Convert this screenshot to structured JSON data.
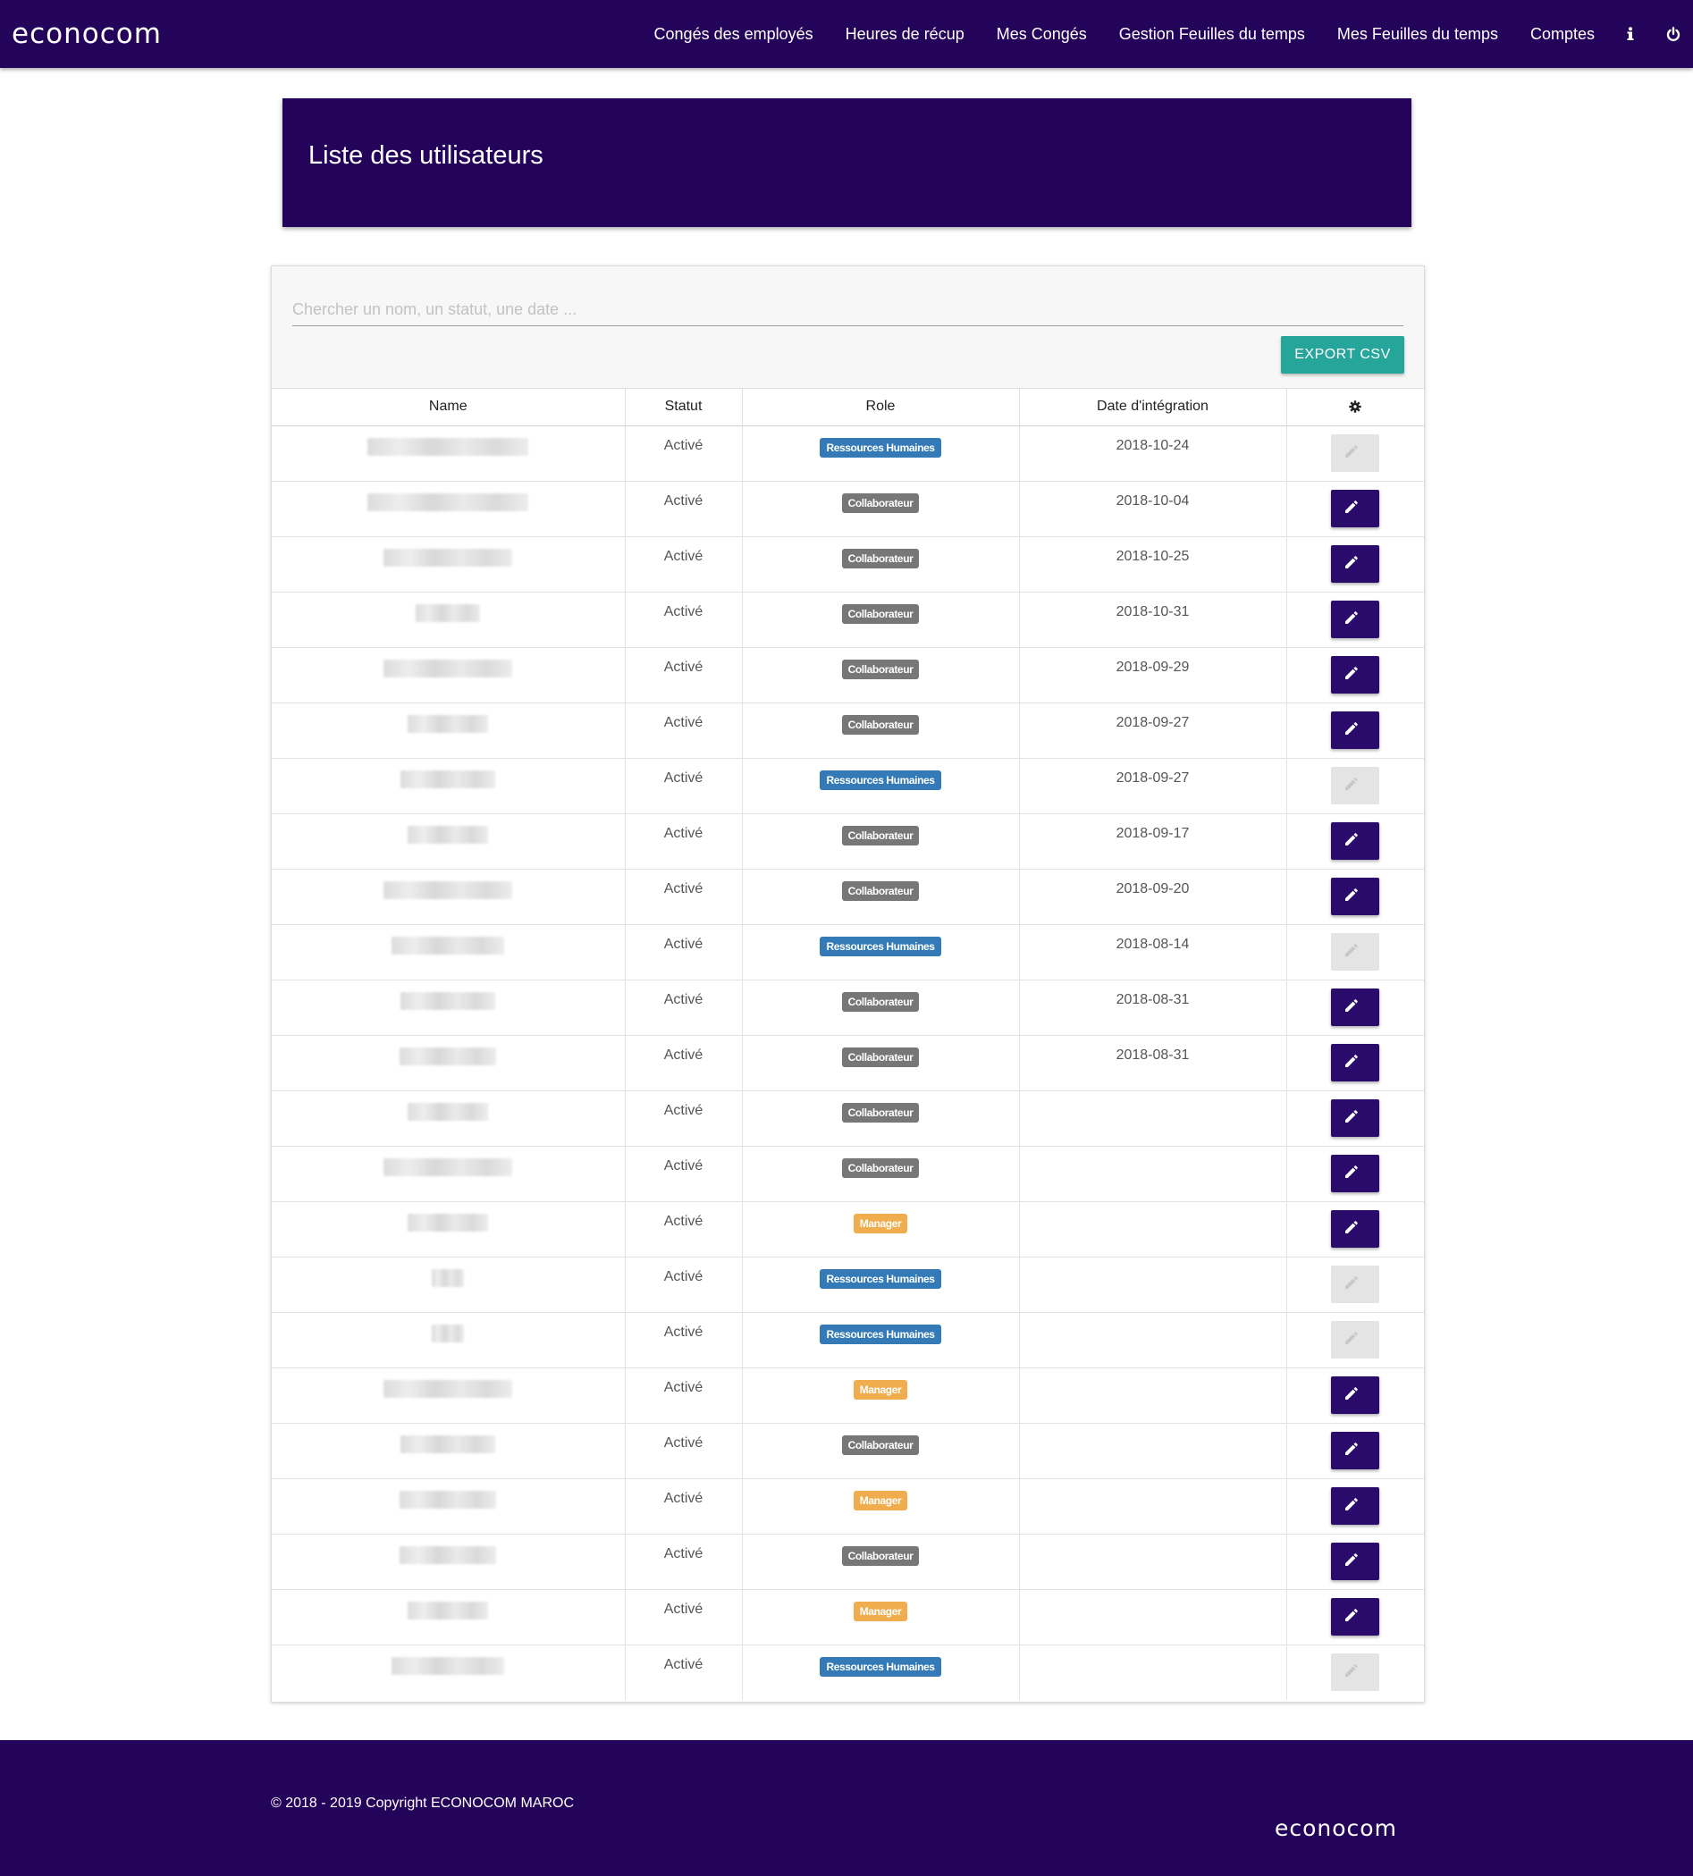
{
  "navbar": {
    "brand": "econocom",
    "links": [
      "Congés des employés",
      "Heures de récup",
      "Mes Congés",
      "Gestion Feuilles du temps",
      "Mes Feuilles du temps",
      "Comptes"
    ],
    "icons": [
      "info-icon",
      "power-icon"
    ]
  },
  "page": {
    "title": "Liste des utilisateurs"
  },
  "search": {
    "placeholder": "Chercher un nom, un statut, une date ...",
    "value": ""
  },
  "toolbar": {
    "export_label": "EXPORT CSV"
  },
  "table": {
    "headers": {
      "name": "Name",
      "status": "Statut",
      "role": "Role",
      "date": "Date d'intégration",
      "actions_icon": "gear-icon"
    },
    "rows": [
      {
        "statut": "Activé",
        "role": "Ressources Humaines",
        "date": "2018-10-24",
        "editable": false
      },
      {
        "statut": "Activé",
        "role": "Collaborateur",
        "date": "2018-10-04",
        "editable": true
      },
      {
        "statut": "Activé",
        "role": "Collaborateur",
        "date": "2018-10-25",
        "editable": true
      },
      {
        "statut": "Activé",
        "role": "Collaborateur",
        "date": "2018-10-31",
        "editable": true
      },
      {
        "statut": "Activé",
        "role": "Collaborateur",
        "date": "2018-09-29",
        "editable": true
      },
      {
        "statut": "Activé",
        "role": "Collaborateur",
        "date": "2018-09-27",
        "editable": true
      },
      {
        "statut": "Activé",
        "role": "Ressources Humaines",
        "date": "2018-09-27",
        "editable": false
      },
      {
        "statut": "Activé",
        "role": "Collaborateur",
        "date": "2018-09-17",
        "editable": true
      },
      {
        "statut": "Activé",
        "role": "Collaborateur",
        "date": "2018-09-20",
        "editable": true
      },
      {
        "statut": "Activé",
        "role": "Ressources Humaines",
        "date": "2018-08-14",
        "editable": false
      },
      {
        "statut": "Activé",
        "role": "Collaborateur",
        "date": "2018-08-31",
        "editable": true
      },
      {
        "statut": "Activé",
        "role": "Collaborateur",
        "date": "2018-08-31",
        "editable": true
      },
      {
        "statut": "Activé",
        "role": "Collaborateur",
        "date": "",
        "editable": true
      },
      {
        "statut": "Activé",
        "role": "Collaborateur",
        "date": "",
        "editable": true
      },
      {
        "statut": "Activé",
        "role": "Manager",
        "date": "",
        "editable": true
      },
      {
        "statut": "Activé",
        "role": "Ressources Humaines",
        "date": "",
        "editable": false
      },
      {
        "statut": "Activé",
        "role": "Ressources Humaines",
        "date": "",
        "editable": false
      },
      {
        "statut": "Activé",
        "role": "Manager",
        "date": "",
        "editable": true
      },
      {
        "statut": "Activé",
        "role": "Collaborateur",
        "date": "",
        "editable": true
      },
      {
        "statut": "Activé",
        "role": "Manager",
        "date": "",
        "editable": true
      },
      {
        "statut": "Activé",
        "role": "Collaborateur",
        "date": "",
        "editable": true
      },
      {
        "statut": "Activé",
        "role": "Manager",
        "date": "",
        "editable": true
      },
      {
        "statut": "Activé",
        "role": "Ressources Humaines",
        "date": "",
        "editable": false
      }
    ]
  },
  "footer": {
    "copyright": "© 2018 - 2019 Copyright ECONOCOM MAROC",
    "brand": "econocom"
  },
  "colors": {
    "primary": "#24045a",
    "export_button": "#26a69a",
    "role_rh": "#337ab7",
    "role_collaborateur": "#777777",
    "role_manager": "#f0ad4e",
    "edit_disabled": "#e4e4e4"
  }
}
